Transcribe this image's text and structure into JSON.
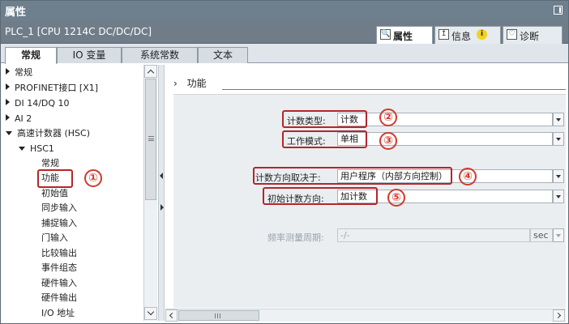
{
  "window": {
    "title": "属性",
    "pin_icon": "pin-icon"
  },
  "device_bar": {
    "device_name": "PLC_1 [CPU 1214C DC/DC/DC]",
    "right_tabs": [
      {
        "label": "属性",
        "icon": "properties-icon",
        "active": true
      },
      {
        "label": "信息",
        "icon": "info-icon",
        "badge": "i",
        "active": false
      },
      {
        "label": "诊断",
        "icon": "diagnostics-icon",
        "active": false
      }
    ]
  },
  "main_tabs": [
    {
      "label": "常规",
      "active": true
    },
    {
      "label": "IO 变量",
      "active": false
    },
    {
      "label": "系统常数",
      "active": false
    },
    {
      "label": "文本",
      "active": false
    }
  ],
  "tree": {
    "items": [
      {
        "label": "常规",
        "expander": "collapsed"
      },
      {
        "label": "PROFINET接口 [X1]",
        "expander": "collapsed"
      },
      {
        "label": "DI 14/DQ 10",
        "expander": "collapsed"
      },
      {
        "label": "AI 2",
        "expander": "collapsed"
      },
      {
        "label": "高速计数器 (HSC)",
        "expander": "expanded"
      },
      {
        "label": "HSC1",
        "expander": "expanded"
      },
      {
        "label": "常规"
      },
      {
        "label": "功能",
        "selected": true
      },
      {
        "label": "初始值"
      },
      {
        "label": "同步输入"
      },
      {
        "label": "捕捉输入"
      },
      {
        "label": "门输入"
      },
      {
        "label": "比较输出"
      },
      {
        "label": "事件组态"
      },
      {
        "label": "硬件输入"
      },
      {
        "label": "硬件输出"
      },
      {
        "label": "I/O 地址"
      }
    ]
  },
  "section": {
    "title": "功能"
  },
  "form": {
    "count_type": {
      "label": "计数类型:",
      "value": "计数"
    },
    "work_mode": {
      "label": "工作模式:",
      "value": "单相"
    },
    "count_direction_source": {
      "label": "计数方向取决于:",
      "value": "用户程序（内部方向控制）"
    },
    "initial_direction": {
      "label": "初始计数方向:",
      "value": "加计数"
    },
    "freq_period": {
      "label": "频率测量周期:",
      "value": "-/-",
      "unit": "sec",
      "disabled": true
    }
  },
  "annotations": [
    "①",
    "②",
    "③",
    "④",
    "⑤"
  ],
  "colors": {
    "title_bar": "#6e7f8d",
    "highlight_box": "#b3262a",
    "badge": "#d23a2a",
    "form_background": "#ebeef1"
  }
}
